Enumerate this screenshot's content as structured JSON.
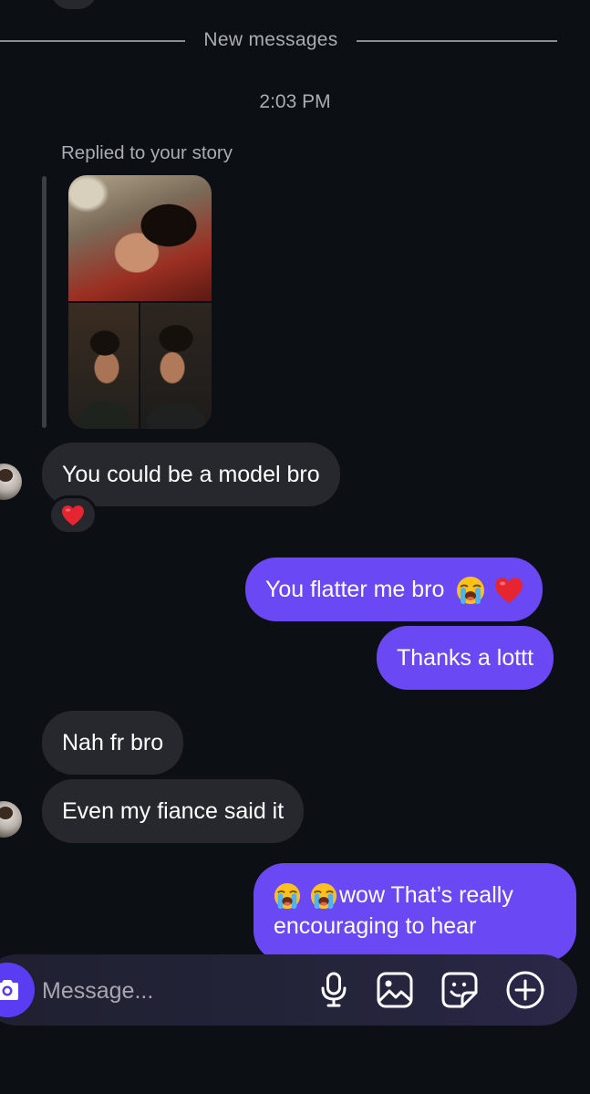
{
  "thread": {
    "divider_label": "New messages",
    "timestamp": "2:03 PM",
    "story_reply_label": "Replied to your story"
  },
  "messages": [
    {
      "side": "in",
      "text": "You could be a model bro",
      "reaction": "heart"
    },
    {
      "side": "out",
      "text": "You flatter me bro",
      "emojis": [
        "loudly-crying-face",
        "red-heart"
      ]
    },
    {
      "side": "out",
      "text": "Thanks a lottt"
    },
    {
      "side": "in",
      "text": "Nah fr bro"
    },
    {
      "side": "in",
      "text": "Even my fiance said it"
    },
    {
      "side": "out",
      "line1": "wow That’s really",
      "line2": "encouraging to hear",
      "emojis": [
        "loudly-crying-face",
        "loudly-crying-face"
      ]
    }
  ],
  "composer": {
    "placeholder": "Message...",
    "icons": [
      "camera-icon",
      "microphone-icon",
      "gallery-icon",
      "sticker-icon",
      "plus-icon"
    ]
  },
  "colors": {
    "background": "#0c0f14",
    "incoming_bubble": "#26282d",
    "outgoing_bubble": "#6a49f5",
    "camera_button": "#5a3cf2"
  }
}
